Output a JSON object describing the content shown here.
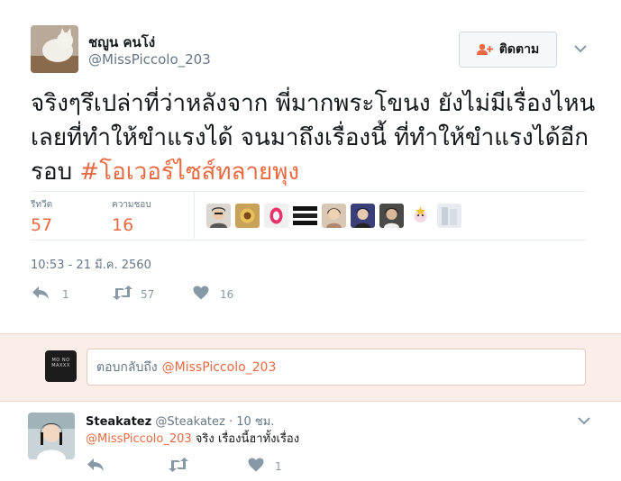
{
  "tweet": {
    "display_name": "ชญูน คนโง่",
    "handle": "@MissPiccolo_203",
    "follow_label": "ติดตาม",
    "text": "จริงๆรึเปล่าที่ว่าหลังจาก พี่มากพระโขนง ยังไม่มีเรื่องไหนเลยที่ทำให้ขำแรงได้ จนมาถึงเรื่องนี้ ที่ทำให้ขำแรงได้อีกรอบ ",
    "hashtag": "#โอเวอร์ไซส์ทลายพุง",
    "retweets_label": "รีทวีต",
    "retweets_count": "57",
    "likes_label": "ความชอบ",
    "likes_count": "16",
    "timestamp": "10:53 - 21 มี.ค. 2560",
    "actions": {
      "reply_count": "1",
      "retweet_count": "57",
      "like_count": "16"
    },
    "liker_avatars": [
      "liker-1",
      "liker-2",
      "liker-3",
      "liker-4",
      "liker-5",
      "liker-6",
      "liker-7",
      "liker-8",
      "liker-9"
    ]
  },
  "reply_box": {
    "avatar_text": "MO NO MAXXX",
    "prefix": "ตอบกลับถึง",
    "mention": "@MissPiccolo_203"
  },
  "reply": {
    "name": "Steakatez",
    "handle": "@Steakatez",
    "time": "· 10 ชม.",
    "mention": "@MissPiccolo_203",
    "text": " จริง เรื่องนี้ฮาทั้งเรื่อง",
    "like_count": "1"
  },
  "colors": {
    "accent": "#e86a43",
    "muted": "#657786",
    "action_icon": "#8899a6",
    "reply_bg": "#fbeee9"
  },
  "icons": [
    "add-user-icon",
    "chevron-down-icon",
    "reply-icon",
    "retweet-icon",
    "heart-icon"
  ]
}
